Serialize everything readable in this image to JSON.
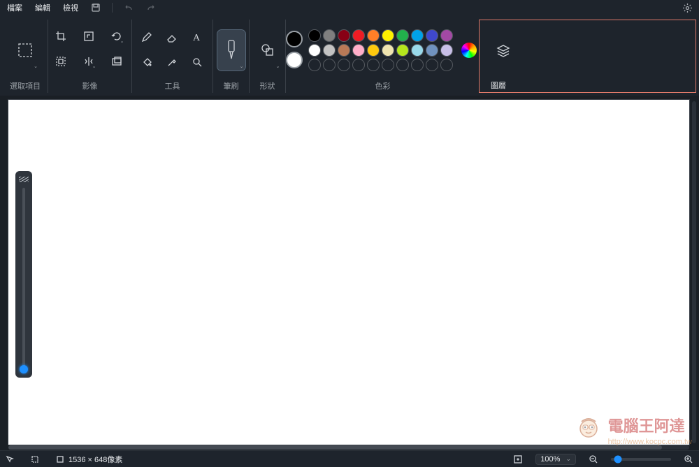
{
  "menu": {
    "file": "檔案",
    "edit": "編輯",
    "view": "檢視"
  },
  "ribbon": {
    "select_label": "選取項目",
    "image_label": "影像",
    "tools_label": "工具",
    "brush_label": "筆刷",
    "shapes_label": "形狀",
    "colors_label": "色彩",
    "layers_label": "圖層",
    "primary_color": "#000000",
    "secondary_color": "#ffffff",
    "palette_row1": [
      "#000000",
      "#7f7f7f",
      "#880015",
      "#ed1c24",
      "#ff7f27",
      "#fff200",
      "#22b14c",
      "#00a2e8",
      "#3f48cc",
      "#a349a4"
    ],
    "palette_row2": [
      "#ffffff",
      "#c3c3c3",
      "#b97a57",
      "#ffaec9",
      "#ffc90e",
      "#efe4b0",
      "#b5e61d",
      "#99d9ea",
      "#7092be",
      "#c8bfe7"
    ],
    "palette_row3_empty_count": 10
  },
  "status": {
    "position": "",
    "selection_size": "",
    "canvas_size": "1536 × 648像素",
    "zoom_label": "100%"
  },
  "watermark": {
    "text": "電腦王阿達",
    "sub": "http://www.kocpc.com.tw"
  }
}
